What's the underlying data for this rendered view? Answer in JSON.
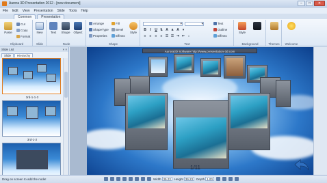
{
  "window": {
    "title": "Aurora 3D Presentation 2012 - [new document]",
    "controls": [
      "–",
      "□",
      "✕"
    ]
  },
  "menu": [
    "File",
    "Edit",
    "View",
    "Presentation",
    "Slide",
    "Tools",
    "Help"
  ],
  "ribbon_tabs": [
    {
      "label": "Common",
      "active": true
    },
    {
      "label": "Presentation",
      "active": false
    }
  ],
  "ribbon": {
    "clipboard": {
      "label": "Clipboard",
      "paste": "Paste",
      "cut": "Cut",
      "copy": "Copy",
      "format": "Format"
    },
    "slide": {
      "label": "Slide",
      "new": "New"
    },
    "node": {
      "label": "Node",
      "text": "Text",
      "shape": "Shape",
      "object": "Object"
    },
    "shape": {
      "label": "Shape",
      "arrange": "Arrange",
      "shape_type": "ShapeType",
      "properties": "Properties",
      "fill": "Fill",
      "bevel": "Bevel",
      "effects": "Effects",
      "style": "Style"
    },
    "text": {
      "label": "Text",
      "bold": "B",
      "italic": "I",
      "underline": "U",
      "text_btn": "Text",
      "outline": "Outline",
      "effects": "Effects"
    },
    "background": {
      "label": "Background",
      "style": "Style"
    },
    "themes": {
      "label": "Themes"
    },
    "welcome": {
      "label": "Welcome"
    }
  },
  "slide_list": {
    "title": "Slide List",
    "close": "× ×",
    "tabs": [
      {
        "label": "Slide",
        "active": false
      },
      {
        "label": "Hierarchy",
        "active": true
      }
    ],
    "thumbnails": [
      {
        "label": "3rd-1-1-3",
        "selected": true
      },
      {
        "label": "3rd-1-2",
        "selected": false
      },
      {
        "label": "",
        "selected": false
      }
    ]
  },
  "stage": {
    "banner": "Aurora3D Software   http://www.presentation-3d.com",
    "page_indicator": "1/11"
  },
  "status": {
    "text": "Drag on screen to add the node!",
    "width_label": "Width",
    "width_value": "39.23",
    "height_label": "Height",
    "height_value": "39.23",
    "depth_label": "Depth",
    "depth_value": "1.00"
  },
  "colors": {
    "accent": "#e07b1d",
    "stage_center": "#ffffff",
    "stage_edge": "#0c3f8c"
  }
}
